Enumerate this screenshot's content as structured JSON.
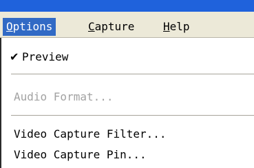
{
  "menubar": {
    "items": [
      {
        "mnemonic": "O",
        "rest": "ptions"
      },
      {
        "mnemonic": "C",
        "rest": "apture"
      },
      {
        "mnemonic": "H",
        "rest": "elp"
      }
    ]
  },
  "dropdown": {
    "check_glyph": "✔",
    "preview_label": "Preview",
    "audio_format_label": "Audio Format...",
    "video_capture_filter_label": "Video Capture Filter...",
    "video_capture_pin_label": "Video Capture Pin..."
  },
  "colors": {
    "menu_highlight": "#316ac5",
    "menubar_bg": "#ece9d8",
    "disabled_text": "#a2a2a2",
    "title_strip": "#1f62dc"
  }
}
